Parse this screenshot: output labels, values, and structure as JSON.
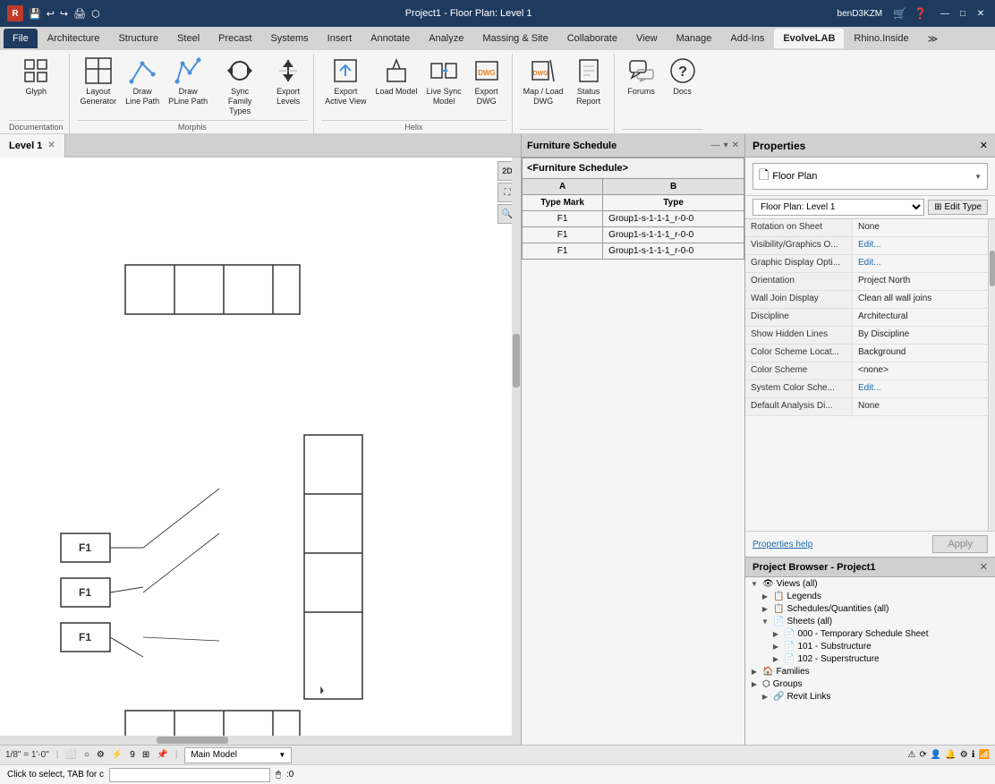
{
  "titlebar": {
    "icon": "R",
    "title": "Project1 - Floor Plan: Level 1",
    "user": "benD3KZM",
    "minimize": "—",
    "maximize": "□",
    "close": "✕"
  },
  "ribbon": {
    "tabs": [
      {
        "label": "File",
        "active": false
      },
      {
        "label": "Architecture",
        "active": false
      },
      {
        "label": "Structure",
        "active": false
      },
      {
        "label": "Steel",
        "active": false
      },
      {
        "label": "Precast",
        "active": false
      },
      {
        "label": "Systems",
        "active": false
      },
      {
        "label": "Insert",
        "active": false
      },
      {
        "label": "Annotate",
        "active": false
      },
      {
        "label": "Analyze",
        "active": false
      },
      {
        "label": "Massing & Site",
        "active": false
      },
      {
        "label": "Collaborate",
        "active": false
      },
      {
        "label": "View",
        "active": false
      },
      {
        "label": "Manage",
        "active": false
      },
      {
        "label": "Add-Ins",
        "active": false
      },
      {
        "label": "EvolveLAB",
        "active": true
      },
      {
        "label": "Rhino.Inside",
        "active": false
      },
      {
        "label": "≫",
        "active": false
      }
    ],
    "groups": [
      {
        "name": "Documentation",
        "items": [
          {
            "label": "Glyph",
            "icon": "⊞"
          }
        ]
      },
      {
        "name": "Morphis",
        "items": [
          {
            "label": "Layout\nGenerator",
            "icon": "▦"
          },
          {
            "label": "Draw\nLine Path",
            "icon": "↗"
          },
          {
            "label": "Draw\nPLine Path",
            "icon": "↗"
          },
          {
            "label": "Sync\nFamily Types",
            "icon": "⟳"
          },
          {
            "label": "Export\nLevels",
            "icon": "↕"
          }
        ]
      },
      {
        "name": "Helix",
        "items": [
          {
            "label": "Export\nActive View",
            "icon": "⬚"
          },
          {
            "label": "Load Model",
            "icon": "📦"
          },
          {
            "label": "Live Sync\nModel",
            "icon": "↔"
          },
          {
            "label": "Export\nDWG",
            "icon": "⬚"
          }
        ]
      },
      {
        "name": "",
        "items": [
          {
            "label": "Map / Load\nDWG",
            "icon": "📌"
          },
          {
            "label": "Status\nReport",
            "icon": "📊"
          }
        ]
      },
      {
        "name": "",
        "items": [
          {
            "label": "Forums",
            "icon": "💬"
          },
          {
            "label": "Docs",
            "icon": "?"
          }
        ]
      }
    ]
  },
  "viewport": {
    "tab_label": "Level 1",
    "scale": "1/8\" = 1'-0\"",
    "view_mode": "2D"
  },
  "schedule": {
    "title": "Furniture Schedule",
    "main_title": "<Furniture Schedule>",
    "columns": [
      "A",
      "B"
    ],
    "col_labels": [
      "Type Mark",
      "Type"
    ],
    "rows": [
      {
        "a": "F1",
        "b": "Group1-s-1-1-1_r-0-0"
      },
      {
        "a": "F1",
        "b": "Group1-s-1-1-1_r-0-0"
      },
      {
        "a": "F1",
        "b": "Group1-s-1-1-1_r-0-0"
      }
    ]
  },
  "properties": {
    "title": "Properties",
    "view_icon": "🗋",
    "view_name": "Floor Plan",
    "level": "Floor Plan: Level 1",
    "edit_type_label": "Edit Type",
    "rows": [
      {
        "name": "Rotation on Sheet",
        "value": "None",
        "editable": false
      },
      {
        "name": "Visibility/Graphics O...",
        "value": "Edit...",
        "editable": true
      },
      {
        "name": "Graphic Display Opti...",
        "value": "Edit...",
        "editable": true
      },
      {
        "name": "Orientation",
        "value": "Project North",
        "editable": false
      },
      {
        "name": "Wall Join Display",
        "value": "Clean all wall joins",
        "editable": false
      },
      {
        "name": "Discipline",
        "value": "Architectural",
        "editable": false
      },
      {
        "name": "Show Hidden Lines",
        "value": "By Discipline",
        "editable": false
      },
      {
        "name": "Color Scheme Locat...",
        "value": "Background",
        "editable": false
      },
      {
        "name": "Color Scheme",
        "value": "<none>",
        "editable": false
      },
      {
        "name": "System Color Sche...",
        "value": "Edit...",
        "editable": true
      },
      {
        "name": "Default Analysis Di...",
        "value": "None",
        "editable": false
      }
    ],
    "help_link": "Properties help",
    "apply_label": "Apply"
  },
  "project_browser": {
    "title": "Project Browser - Project1",
    "items": [
      {
        "label": "Views (all)",
        "indent": 0,
        "icon": "👁",
        "expanded": true
      },
      {
        "label": "Legends",
        "indent": 1,
        "icon": "📋",
        "expanded": false
      },
      {
        "label": "Schedules/Quantities (all)",
        "indent": 1,
        "icon": "📋",
        "expanded": false
      },
      {
        "label": "Sheets (all)",
        "indent": 1,
        "icon": "📄",
        "expanded": true
      },
      {
        "label": "000 - Temporary Schedule Sheet",
        "indent": 2,
        "icon": "📄",
        "expanded": false
      },
      {
        "label": "101 - Substructure",
        "indent": 2,
        "icon": "📄",
        "expanded": false
      },
      {
        "label": "102 - Superstructure",
        "indent": 2,
        "icon": "📄",
        "expanded": false
      },
      {
        "label": "Families",
        "indent": 0,
        "icon": "🏠",
        "expanded": false
      },
      {
        "label": "Groups",
        "indent": 0,
        "icon": "⬡",
        "expanded": false
      },
      {
        "label": "Revit Links",
        "indent": 1,
        "icon": "🔗",
        "expanded": false
      }
    ]
  },
  "status_bar": {
    "scale": "1/8\" = 1'-0\"",
    "model": "Main Model",
    "click_to_select": "Click to select, TAB for c"
  },
  "canvas": {
    "furniture_labels": [
      "F1",
      "F1",
      "F1"
    ]
  }
}
